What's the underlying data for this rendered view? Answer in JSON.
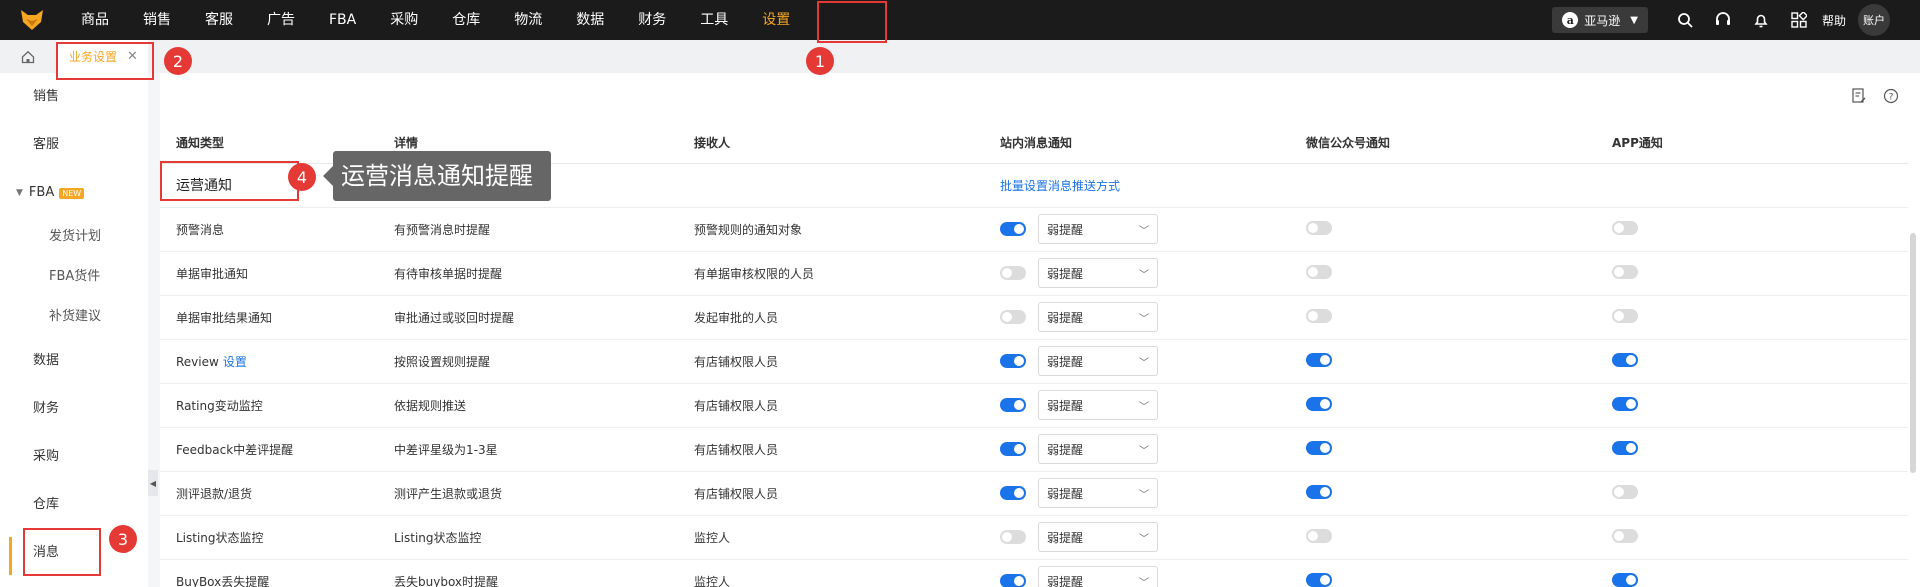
{
  "topnav": {
    "items": [
      "商品",
      "销售",
      "客服",
      "广告",
      "FBA",
      "采购",
      "仓库",
      "物流",
      "数据",
      "财务",
      "工具",
      "设置"
    ],
    "active_index": 11
  },
  "header_right": {
    "store_label": "亚马逊",
    "help_label": "帮助",
    "account_label": "账户"
  },
  "tabs": {
    "active_tab": "业务设置"
  },
  "sidebar": {
    "items": [
      "销售",
      "客服",
      "FBA",
      "数据",
      "财务",
      "采购",
      "仓库",
      "消息"
    ],
    "fba_badge": "NEW",
    "fba_children": [
      "发货计划",
      "FBA货件",
      "补货建议"
    ],
    "active_item": "消息"
  },
  "table": {
    "headers": [
      "通知类型",
      "详情",
      "接收人",
      "站内消息通知",
      "微信公众号通知",
      "APP通知"
    ],
    "section_title": "运营通知",
    "batch_link": "批量设置消息推送方式",
    "rows": [
      {
        "type": "预警消息",
        "link": "",
        "detail": "有预警消息时提醒",
        "receiver": "预警规则的通知对象",
        "site_on": true,
        "site_level": "弱提醒",
        "wechat_on": false,
        "app_on": false
      },
      {
        "type": "单据审批通知",
        "link": "",
        "detail": "有待审核单据时提醒",
        "receiver": "有单据审核权限的人员",
        "site_on": false,
        "site_level": "弱提醒",
        "wechat_on": false,
        "app_on": false
      },
      {
        "type": "单据审批结果通知",
        "link": "",
        "detail": "审批通过或驳回时提醒",
        "receiver": "发起审批的人员",
        "site_on": false,
        "site_level": "弱提醒",
        "wechat_on": false,
        "app_on": false
      },
      {
        "type": "Review",
        "link": "设置",
        "detail": "按照设置规则提醒",
        "receiver": "有店铺权限人员",
        "site_on": true,
        "site_level": "弱提醒",
        "wechat_on": true,
        "app_on": true
      },
      {
        "type": "Rating变动监控",
        "link": "",
        "detail": "依据规则推送",
        "receiver": "有店铺权限人员",
        "site_on": true,
        "site_level": "弱提醒",
        "wechat_on": true,
        "app_on": true
      },
      {
        "type": "Feedback中差评提醒",
        "link": "",
        "detail": "中差评星级为1-3星",
        "receiver": "有店铺权限人员",
        "site_on": true,
        "site_level": "弱提醒",
        "wechat_on": true,
        "app_on": true
      },
      {
        "type": "测评退款/退货",
        "link": "",
        "detail": "测评产生退款或退货",
        "receiver": "有店铺权限人员",
        "site_on": true,
        "site_level": "弱提醒",
        "wechat_on": true,
        "app_on": false
      },
      {
        "type": "Listing状态监控",
        "link": "",
        "detail": "Listing状态监控",
        "receiver": "监控人",
        "site_on": false,
        "site_level": "弱提醒",
        "wechat_on": false,
        "app_on": false
      },
      {
        "type": "BuyBox丢失提醒",
        "link": "",
        "detail": "丢失buybox时提醒",
        "receiver": "监控人",
        "site_on": true,
        "site_level": "弱提醒",
        "wechat_on": true,
        "app_on": true
      }
    ]
  },
  "annotations": {
    "nums": [
      "1",
      "2",
      "3",
      "4"
    ],
    "tooltip": "运营消息通知提醒",
    "color": "#e53935"
  },
  "colors": {
    "accent": "#f5a623",
    "link": "#1a73e8",
    "topbar": "#1b1b1b"
  }
}
